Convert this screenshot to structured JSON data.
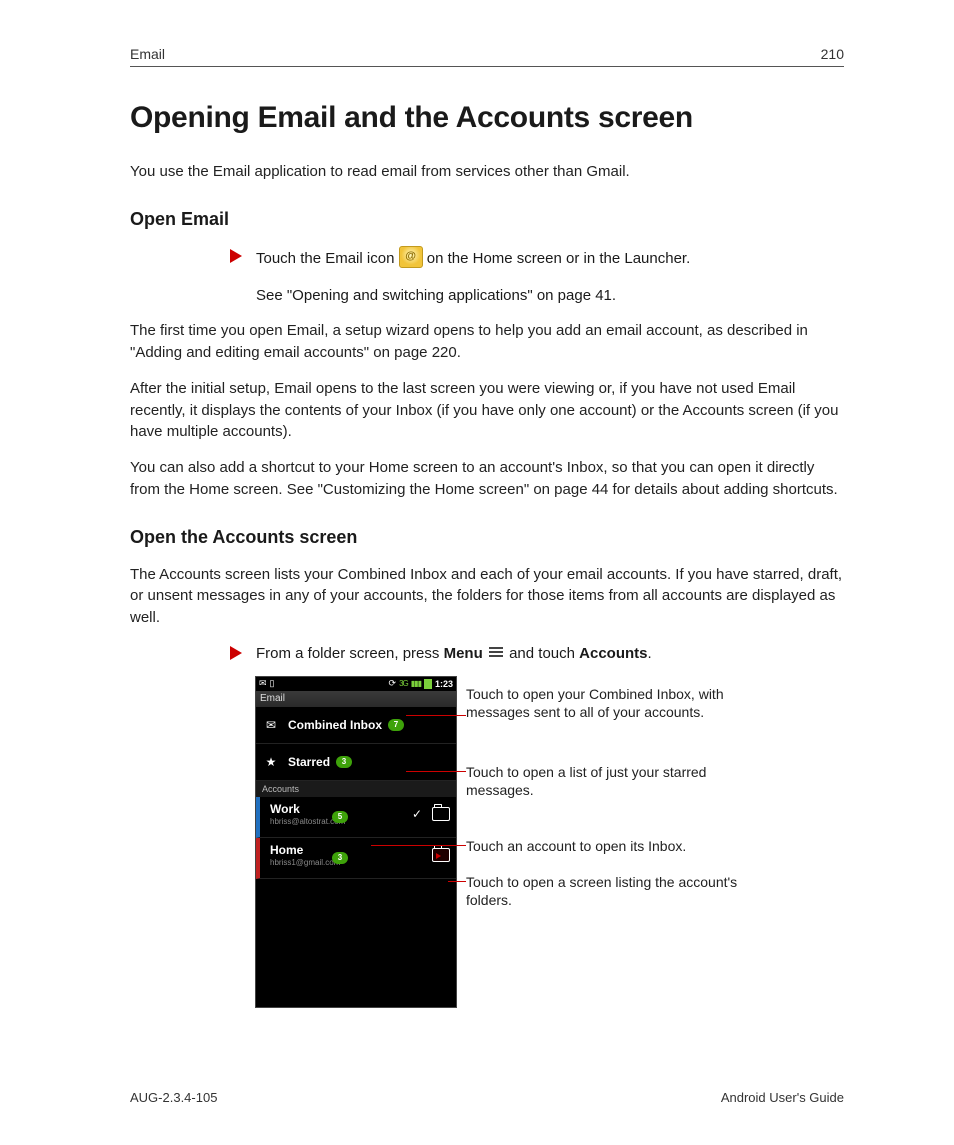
{
  "header": {
    "section": "Email",
    "page": "210"
  },
  "title": "Opening Email and the Accounts screen",
  "intro": "You use the Email application to read email from services other than Gmail.",
  "openEmail": {
    "heading": "Open Email",
    "actionPrefix": "Touch the Email icon ",
    "actionSuffix": " on the Home screen or in the Launcher.",
    "seeline": "See \"Opening and switching applications\" on page 41.",
    "p1": "The first time you open Email, a setup wizard opens to help you add an email account, as described in \"Adding and editing email accounts\" on page 220.",
    "p2": "After the initial setup, Email opens to the last screen you were viewing or, if you have not used Email recently, it displays the contents of your Inbox (if you have only one account) or the Accounts screen (if you have multiple accounts).",
    "p3": "You can also add a shortcut to your Home screen to an account's Inbox, so that you can open it directly from the Home screen. See \"Customizing the Home screen\" on page 44 for details about adding shortcuts."
  },
  "openAccounts": {
    "heading": "Open the Accounts screen",
    "p1": "The Accounts screen lists your Combined Inbox and each of your email accounts. If you have starred, draft, or unsent messages in any of your accounts, the folders for those items from all accounts are displayed as well.",
    "actionPrefix": "From a folder screen, press ",
    "menu": "Menu",
    "actionMiddle": " and touch ",
    "accounts": "Accounts",
    "actionSuffix": "."
  },
  "phone": {
    "time": "1:23",
    "appTitle": "Email",
    "combined": "Combined Inbox",
    "combinedBadge": "7",
    "starred": "Starred",
    "starredBadge": "3",
    "sectionLabel": "Accounts",
    "work": "Work",
    "workEmail": "hbriss@altostrat.com",
    "workBadge": "5",
    "home": "Home",
    "homeEmail": "hbriss1@gmail.com",
    "homeBadge": "3"
  },
  "callouts": {
    "c1": "Touch to open your Combined Inbox, with messages sent to all of your accounts.",
    "c2": "Touch to open a list of just your starred messages.",
    "c3": "Touch an account to open its Inbox.",
    "c4": "Touch to open a screen listing the account's folders."
  },
  "footer": {
    "left": "AUG-2.3.4-105",
    "right": "Android User's Guide"
  }
}
